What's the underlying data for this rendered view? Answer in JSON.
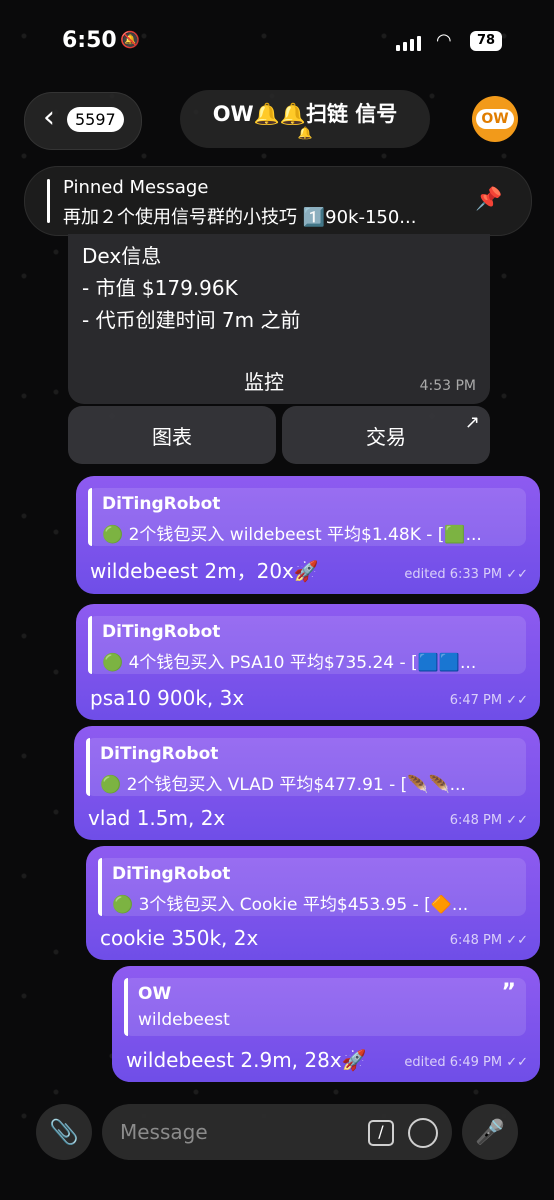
{
  "status_bar": {
    "time": "6:50",
    "battery": "78"
  },
  "header": {
    "back_count": "5597",
    "title": "OW🔔🔔扫链 信号",
    "subtitle": "🔔"
  },
  "avatar_text": "OW",
  "pinned": {
    "title": "Pinned Message",
    "text": "再加２个使用信号群的小技巧 1️⃣90k-150..."
  },
  "dex_card": {
    "title": "Dex信息",
    "line1": "- 市值 $179.96K",
    "line2": "- 代币创建时间 7m 之前",
    "line3": "监控",
    "time": "4:53 PM"
  },
  "buttons": {
    "chart": "图表",
    "trade": "交易"
  },
  "messages": [
    {
      "quote_name": "DiTingRobot",
      "quote_text": "🟢 2个钱包买入 wildebeest 平均$1.48K - [🟩...",
      "text": "wildebeest 2m，20x🚀",
      "time": "edited 6:33 PM ✓✓"
    },
    {
      "quote_name": "DiTingRobot",
      "quote_text": "🟢 4个钱包买入 PSA10 平均$735.24 - [🟦🟦...",
      "text": "psa10 900k, 3x",
      "time": "6:47 PM ✓✓"
    },
    {
      "quote_name": "DiTingRobot",
      "quote_text": "🟢 2个钱包买入 VLAD 平均$477.91 - [🪶🪶...",
      "text": "vlad 1.5m, 2x",
      "time": "6:48 PM ✓✓"
    },
    {
      "quote_name": "DiTingRobot",
      "quote_text": "🟢 3个钱包买入 Cookie 平均$453.95 - [🔶...",
      "text": "cookie 350k, 2x",
      "time": "6:48 PM ✓✓"
    },
    {
      "quote_name": "OW",
      "quote_text": "wildebeest",
      "text": "wildebeest 2.9m, 28x🚀",
      "time": "edited 6:49 PM ✓✓"
    }
  ],
  "composer": {
    "placeholder": "Message"
  },
  "icons": [
    "bell-off-icon",
    "wifi-icon",
    "back-chevron-icon",
    "pin-icon",
    "external-arrow-icon",
    "quote-icon",
    "paperclip-icon",
    "command-icon",
    "sticker-icon",
    "mic-icon"
  ]
}
